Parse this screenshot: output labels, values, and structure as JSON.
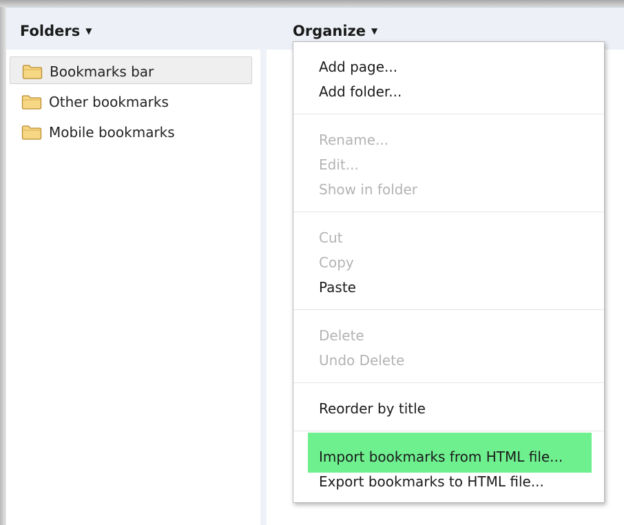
{
  "header": {
    "folders_label": "Folders",
    "organize_label": "Organize"
  },
  "folders": [
    {
      "label": "Bookmarks bar",
      "selected": true
    },
    {
      "label": "Other bookmarks",
      "selected": false
    },
    {
      "label": "Mobile bookmarks",
      "selected": false
    }
  ],
  "organize_menu": {
    "add_page": "Add page...",
    "add_folder": "Add folder...",
    "rename": "Rename...",
    "edit": "Edit...",
    "show_in_folder": "Show in folder",
    "cut": "Cut",
    "copy": "Copy",
    "paste": "Paste",
    "delete": "Delete",
    "undo_delete": "Undo Delete",
    "reorder_by_title": "Reorder by title",
    "import_bookmarks": "Import bookmarks from HTML file...",
    "export_bookmarks": "Export bookmarks to HTML file..."
  },
  "icons": {
    "folder": "folder-icon",
    "dropdown": "caret-down-icon"
  },
  "colors": {
    "header_background": "#edf1f7",
    "highlight": "#6ef08f",
    "disabled_text": "#b3b3b3",
    "folder_fill": "#f6d783",
    "folder_stroke": "#b88a2e"
  }
}
